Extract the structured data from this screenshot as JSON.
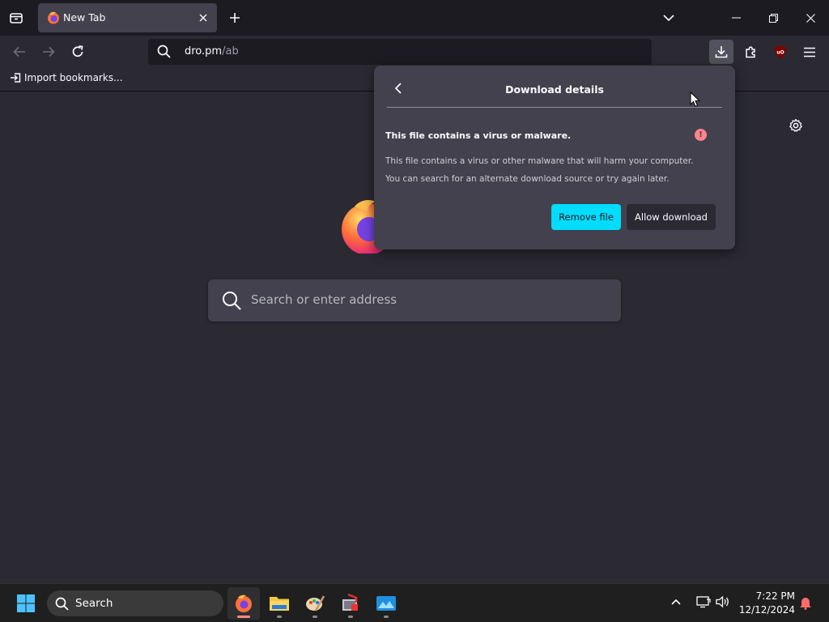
{
  "tab": {
    "title": "New Tab"
  },
  "url": {
    "host": "dro.pm",
    "path": "/ab"
  },
  "bookmarks": {
    "import_label": "Import bookmarks..."
  },
  "newtab": {
    "search_placeholder": "Search or enter address"
  },
  "download_panel": {
    "title": "Download details",
    "heading": "This file contains a virus or malware.",
    "description_line1": "This file contains a virus or other malware that will harm your computer.",
    "description_line2": "You can search for an alternate download source or try again later.",
    "warning_icon_glyph": "!",
    "remove_label": "Remove file",
    "allow_label": "Allow download"
  },
  "taskbar": {
    "search_label": "Search",
    "clock_time": "7:22 PM",
    "clock_date": "12/12/2024"
  },
  "colors": {
    "accent": "#00ddff",
    "warning": "#ff848b",
    "panel_bg": "#42414d",
    "page_bg": "#2b2a33"
  }
}
